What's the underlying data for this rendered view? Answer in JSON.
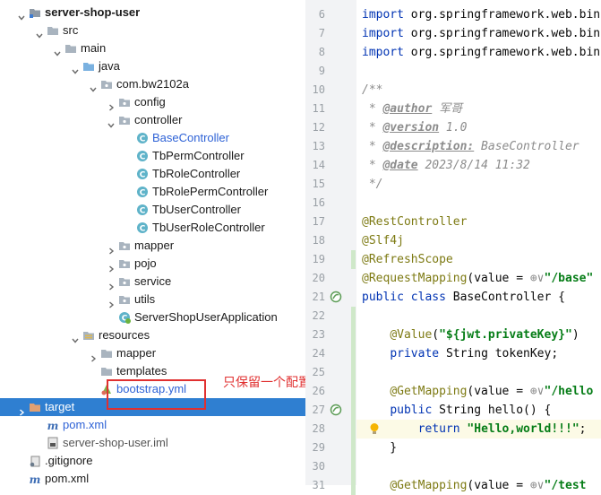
{
  "tree": {
    "rows": [
      {
        "label": "server-shop-user",
        "bold": true,
        "expanded": true,
        "icon": "module-folder-icon"
      },
      {
        "label": "src",
        "expanded": true,
        "icon": "folder-icon"
      },
      {
        "label": "main",
        "expanded": true,
        "icon": "folder-icon"
      },
      {
        "label": "java",
        "expanded": true,
        "icon": "source-root-folder-icon"
      },
      {
        "label": "com.bw2102a",
        "expanded": true,
        "icon": "package-icon"
      },
      {
        "label": "config",
        "expanded": false,
        "icon": "package-icon"
      },
      {
        "label": "controller",
        "expanded": true,
        "icon": "package-icon"
      },
      {
        "label": "BaseController",
        "icon": "class-icon",
        "blue": true
      },
      {
        "label": "TbPermController",
        "icon": "class-icon"
      },
      {
        "label": "TbRoleController",
        "icon": "class-icon"
      },
      {
        "label": "TbRolePermController",
        "icon": "class-icon"
      },
      {
        "label": "TbUserController",
        "icon": "class-icon"
      },
      {
        "label": "TbUserRoleController",
        "icon": "class-icon"
      },
      {
        "label": "mapper",
        "expanded": false,
        "icon": "package-icon"
      },
      {
        "label": "pojo",
        "expanded": false,
        "icon": "package-icon"
      },
      {
        "label": "service",
        "expanded": false,
        "icon": "package-icon"
      },
      {
        "label": "utils",
        "expanded": false,
        "icon": "package-icon"
      },
      {
        "label": "ServerShopUserApplication",
        "icon": "spring-boot-class-icon"
      },
      {
        "label": "resources",
        "expanded": true,
        "icon": "resources-folder-icon"
      },
      {
        "label": "mapper",
        "expanded": false,
        "icon": "folder-icon"
      },
      {
        "label": "templates",
        "icon": "folder-icon"
      },
      {
        "label": "bootstrap.yml",
        "icon": "yaml-file-icon",
        "blue": true
      },
      {
        "label": "target",
        "expanded": false,
        "icon": "excluded-folder-icon",
        "selected": true
      },
      {
        "label": "pom.xml",
        "icon": "maven-icon",
        "blue": true
      },
      {
        "label": "server-shop-user.iml",
        "icon": "iml-file-icon",
        "gray": true
      },
      {
        "label": ".gitignore",
        "icon": "gitignore-icon"
      },
      {
        "label": "pom.xml",
        "icon": "maven-icon"
      }
    ]
  },
  "annotation": {
    "text": "只保留一个配置文件"
  },
  "editor": {
    "lines": [
      {
        "n": "6",
        "code": [
          {
            "t": "import ",
            "c": "kw"
          },
          {
            "t": "org.springframework.web.bin"
          }
        ]
      },
      {
        "n": "7",
        "code": [
          {
            "t": "import ",
            "c": "kw"
          },
          {
            "t": "org.springframework.web.bin"
          }
        ]
      },
      {
        "n": "8",
        "code": [
          {
            "t": "import ",
            "c": "kw"
          },
          {
            "t": "org.springframework.web.bin"
          }
        ]
      },
      {
        "n": "9",
        "code": []
      },
      {
        "n": "10",
        "code": [
          {
            "t": "/**",
            "c": "cm"
          }
        ]
      },
      {
        "n": "11",
        "code": [
          {
            "t": " * ",
            "c": "cm"
          },
          {
            "t": "@author",
            "c": "tag"
          },
          {
            "t": " 军哥",
            "c": "cm"
          }
        ]
      },
      {
        "n": "12",
        "code": [
          {
            "t": " * ",
            "c": "cm"
          },
          {
            "t": "@version",
            "c": "tag"
          },
          {
            "t": " 1.0",
            "c": "cm"
          }
        ]
      },
      {
        "n": "13",
        "code": [
          {
            "t": " * ",
            "c": "cm"
          },
          {
            "t": "@description:",
            "c": "tag"
          },
          {
            "t": " BaseController",
            "c": "cm"
          }
        ]
      },
      {
        "n": "14",
        "code": [
          {
            "t": " * ",
            "c": "cm"
          },
          {
            "t": "@date",
            "c": "tag"
          },
          {
            "t": " 2023/8/14 11:32",
            "c": "cm"
          }
        ]
      },
      {
        "n": "15",
        "code": [
          {
            "t": " */",
            "c": "cm"
          }
        ]
      },
      {
        "n": "16",
        "code": []
      },
      {
        "n": "17",
        "code": [
          {
            "t": "@RestController",
            "c": "ann"
          }
        ]
      },
      {
        "n": "18",
        "code": [
          {
            "t": "@Slf4j",
            "c": "ann"
          }
        ]
      },
      {
        "n": "19",
        "code": [
          {
            "t": "@RefreshScope",
            "c": "ann"
          }
        ]
      },
      {
        "n": "20",
        "code": [
          {
            "t": "@RequestMapping",
            "c": "ann"
          },
          {
            "t": "(value = "
          },
          {
            "t": "⊕∨",
            "c": "hint"
          },
          {
            "t": "\"/base\"",
            "c": "str"
          }
        ]
      },
      {
        "n": "21",
        "code": [
          {
            "t": "public class ",
            "c": "kw"
          },
          {
            "t": "BaseController {"
          }
        ]
      },
      {
        "n": "22",
        "code": []
      },
      {
        "n": "23",
        "code": [
          {
            "t": "    "
          },
          {
            "t": "@Value",
            "c": "ann"
          },
          {
            "t": "("
          },
          {
            "t": "\"${jwt.privateKey}\"",
            "c": "str"
          },
          {
            "t": ")"
          }
        ]
      },
      {
        "n": "24",
        "code": [
          {
            "t": "    "
          },
          {
            "t": "private ",
            "c": "kw"
          },
          {
            "t": "String tokenKey;"
          }
        ]
      },
      {
        "n": "25",
        "code": []
      },
      {
        "n": "26",
        "code": [
          {
            "t": "    "
          },
          {
            "t": "@GetMapping",
            "c": "ann"
          },
          {
            "t": "(value = "
          },
          {
            "t": "⊕∨",
            "c": "hint"
          },
          {
            "t": "\"/hello",
            "c": "str"
          }
        ]
      },
      {
        "n": "27",
        "code": [
          {
            "t": "    "
          },
          {
            "t": "public ",
            "c": "kw"
          },
          {
            "t": "String hello() {"
          }
        ]
      },
      {
        "n": "28",
        "code": [
          {
            "t": "        "
          },
          {
            "t": "return ",
            "c": "kw"
          },
          {
            "t": "\"Hello,world!!!\"",
            "c": "str"
          },
          {
            "t": ";"
          }
        ]
      },
      {
        "n": "29",
        "code": [
          {
            "t": "    }"
          }
        ]
      },
      {
        "n": "30",
        "code": []
      },
      {
        "n": "31",
        "code": [
          {
            "t": "    "
          },
          {
            "t": "@GetMapping",
            "c": "ann"
          },
          {
            "t": "(value = "
          },
          {
            "t": "⊕∨",
            "c": "hint"
          },
          {
            "t": "\"/test",
            "c": "str"
          }
        ]
      }
    ]
  }
}
